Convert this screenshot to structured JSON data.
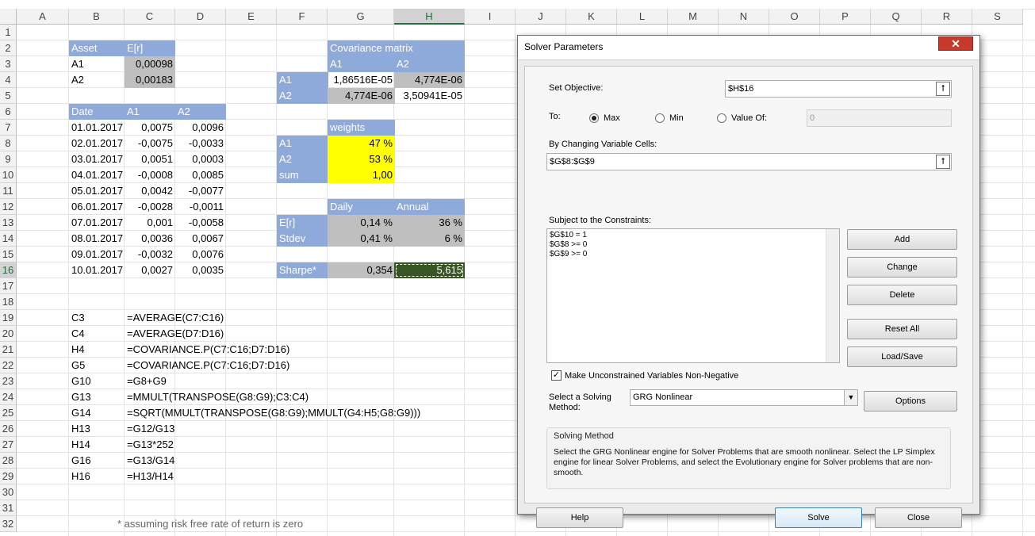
{
  "columns": [
    "A",
    "B",
    "C",
    "D",
    "E",
    "F",
    "G",
    "H",
    "I",
    "J",
    "K",
    "L",
    "M",
    "N",
    "O",
    "P",
    "Q",
    "R",
    "S"
  ],
  "rows": [
    "1",
    "2",
    "3",
    "4",
    "5",
    "6",
    "7",
    "8",
    "9",
    "10",
    "11",
    "12",
    "13",
    "14",
    "15",
    "16",
    "17",
    "18",
    "19",
    "20",
    "21",
    "22",
    "23",
    "24",
    "25",
    "26",
    "27",
    "28",
    "29",
    "30",
    "31",
    "32"
  ],
  "assets_table": {
    "header": [
      "Asset",
      "E[r]"
    ],
    "rows": [
      [
        "A1",
        "0,00098"
      ],
      [
        "A2",
        "0,00183"
      ]
    ]
  },
  "returns_table": {
    "header": [
      "Date",
      "A1",
      "A2"
    ],
    "rows": [
      [
        "01.01.2017",
        "0,0075",
        "0,0096"
      ],
      [
        "02.01.2017",
        "-0,0075",
        "-0,0033"
      ],
      [
        "03.01.2017",
        "0,0051",
        "0,0003"
      ],
      [
        "04.01.2017",
        "-0,0008",
        "0,0085"
      ],
      [
        "05.01.2017",
        "0,0042",
        "-0,0077"
      ],
      [
        "06.01.2017",
        "-0,0028",
        "-0,0011"
      ],
      [
        "07.01.2017",
        "0,001",
        "-0,0058"
      ],
      [
        "08.01.2017",
        "0,0036",
        "0,0067"
      ],
      [
        "09.01.2017",
        "-0,0032",
        "0,0076"
      ],
      [
        "10.01.2017",
        "0,0027",
        "0,0035"
      ]
    ]
  },
  "covariance": {
    "title": "Covariance matrix",
    "col_headers": [
      "A1",
      "A2"
    ],
    "rows": [
      [
        "A1",
        "1,86516E-05",
        "4,774E-06"
      ],
      [
        "A2",
        "4,774E-06",
        "3,50941E-05"
      ]
    ]
  },
  "weights": {
    "title": "weights",
    "rows": [
      [
        "A1",
        "47 %"
      ],
      [
        "A2",
        "53 %"
      ],
      [
        "sum",
        "1,00"
      ]
    ]
  },
  "stats": {
    "headers": [
      "Daily",
      "Annual"
    ],
    "rows": [
      [
        "E[r]",
        "0,14 %",
        "36 %"
      ],
      [
        "Stdev",
        "0,41 %",
        "6 %"
      ]
    ],
    "sharpe": [
      "Sharpe*",
      "0,354",
      "5,615"
    ]
  },
  "formulas": [
    [
      "C3",
      "=AVERAGE(C7:C16)"
    ],
    [
      "C4",
      "=AVERAGE(D7:D16)"
    ],
    [
      "H4",
      "=COVARIANCE.P(C7:C16;D7:D16)"
    ],
    [
      "G5",
      "=COVARIANCE.P(C7:C16;D7:D16)"
    ],
    [
      "G10",
      "=G8+G9"
    ],
    [
      "G13",
      "=MMULT(TRANSPOSE(G8:G9);C3:C4)"
    ],
    [
      "G14",
      "=SQRT(MMULT(TRANSPOSE(G8:G9);MMULT(G4:H5;G8:G9)))"
    ],
    [
      "H13",
      "=G12/G13"
    ],
    [
      "H14",
      "=G13*252"
    ],
    [
      "G16",
      "=G13/G14"
    ],
    [
      "H16",
      "=H13/H14"
    ]
  ],
  "footnote": "* assuming risk free rate of return is zero",
  "solver": {
    "title": "Solver Parameters",
    "close_glyph": "✕",
    "set_objective_label": "Set Objective:",
    "objective_value": "$H$16",
    "to_label": "To:",
    "max_label": "Max",
    "min_label": "Min",
    "value_of_label": "Value Of:",
    "value_of_value": "0",
    "changing_label": "By Changing Variable Cells:",
    "changing_value": "$G$8:$G$9",
    "constraints_label": "Subject to the Constraints:",
    "constraints": [
      "$G$10 = 1",
      "$G$8 >= 0",
      "$G$9 >= 0"
    ],
    "add_label": "Add",
    "change_label": "Change",
    "delete_label": "Delete",
    "reset_label": "Reset All",
    "loadsave_label": "Load/Save",
    "nonneg_label": "Make Unconstrained Variables Non-Negative",
    "method_label_1": "Select a Solving",
    "method_label_2": "Method:",
    "method_value": "GRG Nonlinear",
    "options_label": "Options",
    "group_title": "Solving Method",
    "group_text": "Select the GRG Nonlinear engine for Solver Problems that are smooth nonlinear. Select the LP Simplex engine for linear Solver Problems, and select the Evolutionary engine for Solver problems that are non-smooth.",
    "help_label": "Help",
    "solve_label": "Solve",
    "close_label": "Close"
  }
}
